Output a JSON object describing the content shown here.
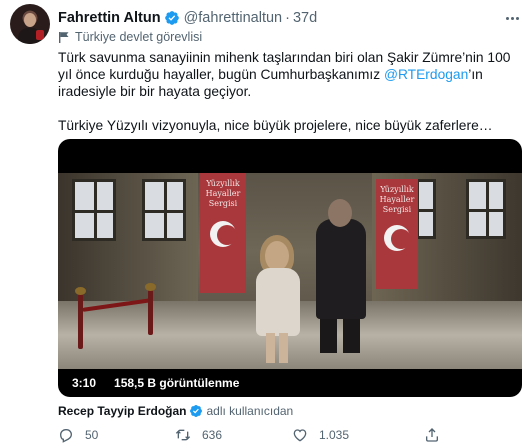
{
  "author": {
    "name": "Fahrettin Altun",
    "handle": "@fahrettinaltun",
    "separator": "·",
    "time": "37d",
    "label": "Türkiye devlet görevlisi"
  },
  "tweet": {
    "para1_before": "Türk savunma sanayiinin mihenk taşlarından biri olan Şakir Zümre’nin 100 yıl önce kurduğu hayaller, bugün Cumhurbaşkanımız ",
    "mention": "@RTErdogan",
    "para1_after": "’ın iradesiyle bir bir hayata geçiyor.",
    "para2": "Türkiye Yüzyılı vizyonuyla, nice büyük projelere, nice büyük zaferlere…"
  },
  "media": {
    "banner_text_left": "Yüzyıllık Hayaller Sergisi",
    "banner_text_right": "Yüzyıllık Hayaller Sergisi",
    "duration": "3:10",
    "views": "158,5 B görüntülenme"
  },
  "attribution": {
    "name": "Recep Tayyip Erdoğan",
    "suffix": "adlı kullanıcıdan"
  },
  "actions": {
    "replies": "50",
    "retweets": "636",
    "likes": "1.035"
  },
  "colors": {
    "accent": "#1d9bf0",
    "text": "#0f1419",
    "muted": "#536471"
  },
  "icons": [
    "verified-badge-icon",
    "flag-icon",
    "more-icon",
    "reply-icon",
    "retweet-icon",
    "like-icon",
    "share-icon"
  ]
}
